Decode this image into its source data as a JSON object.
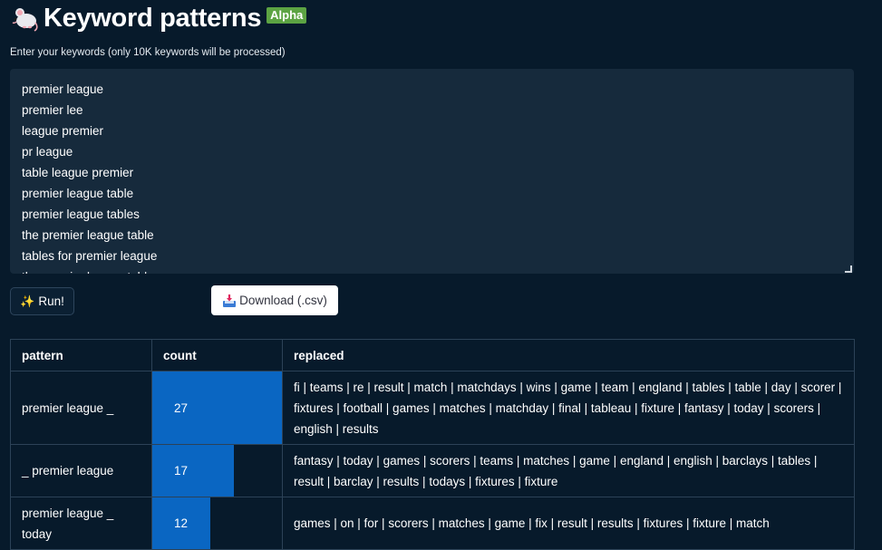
{
  "header": {
    "title": "Keyword patterns",
    "badge": "Alpha",
    "icon": "mouse-icon"
  },
  "input": {
    "label": "Enter your keywords (only 10K keywords will be processed)",
    "lines": [
      "premier league",
      "premier lee",
      "league premier",
      "pr league",
      "table league premier",
      "premier league table",
      "premier league tables",
      "the premier league table",
      "tables for premier league",
      "the premier league tables"
    ]
  },
  "buttons": {
    "run_label": "Run!",
    "download_label": "Download (.csv)"
  },
  "table": {
    "columns": [
      "pattern",
      "count",
      "replaced"
    ],
    "max_count": 27,
    "rows": [
      {
        "pattern": "premier league _",
        "count": 27,
        "replaced": "fi | teams | re | result | match | matchdays | wins | game | team | england | tables | table | day | scorer | fixtures | football | games | matches | matchday | final | tableau | fixture | fantasy | today | scorers | english | results"
      },
      {
        "pattern": "_ premier league",
        "count": 17,
        "replaced": "fantasy | today | games | scorers | teams | matches | game | england | english | barclays | tables | result | barclay | results | todays | fixtures | fixture"
      },
      {
        "pattern": "premier league _ today",
        "count": 12,
        "replaced": "games | on | for | scorers | matches | game | fix | result | results | fixtures | fixture | match"
      }
    ]
  },
  "colors": {
    "background": "#071a2b",
    "textarea_bg": "#162a3c",
    "bar": "#0a66c2",
    "badge": "#5ca343"
  }
}
